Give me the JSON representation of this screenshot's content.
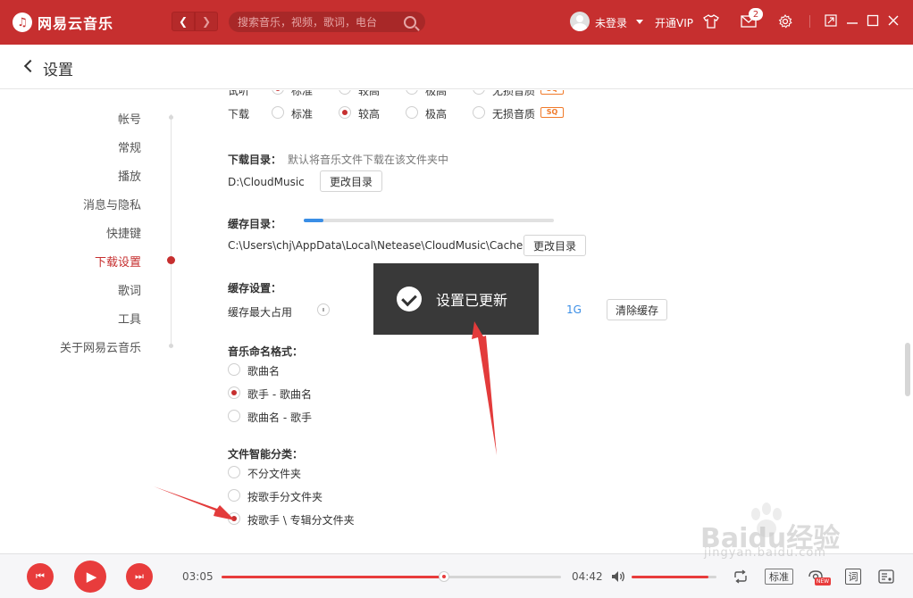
{
  "app": {
    "name": "网易云音乐",
    "logo_glyph": "♫"
  },
  "titlebar": {
    "search_placeholder": "搜索音乐，视频，歌词，电台",
    "login_text": "未登录",
    "vip_text": "开通VIP",
    "mail_count": "2",
    "accent_color": "#c62f2f"
  },
  "header": {
    "title": "设置"
  },
  "menu": {
    "items": [
      {
        "label": "帐号",
        "active": false
      },
      {
        "label": "常规",
        "active": false
      },
      {
        "label": "播放",
        "active": false
      },
      {
        "label": "消息与隐私",
        "active": false
      },
      {
        "label": "快捷键",
        "active": false
      },
      {
        "label": "下载设置",
        "active": true
      },
      {
        "label": "歌词",
        "active": false
      },
      {
        "label": "工具",
        "active": false
      },
      {
        "label": "关于网易云音乐",
        "active": false
      }
    ]
  },
  "settings": {
    "quality": {
      "row_label_partial": "试听",
      "download_label": "下载",
      "options": [
        "标准",
        "较高",
        "极高",
        "无损音质"
      ],
      "sq_badge": "SQ",
      "selected_download": "较高",
      "selected_trial": "标准"
    },
    "download_dir": {
      "title": "下载目录：",
      "description": "默认将音乐文件下载在该文件夹中",
      "path": "D:\\CloudMusic",
      "button": "更改目录"
    },
    "cache_dir": {
      "title": "缓存目录：",
      "path": "C:\\Users\\chj\\AppData\\Local\\Netease\\CloudMusic\\Cache",
      "button": "更改目录"
    },
    "cache_settings": {
      "title": "缓存设置：",
      "max_label": "缓存最大占用",
      "max_value": "1G",
      "slider_fraction": 0.08,
      "clear_button": "清除缓存"
    },
    "naming": {
      "title": "音乐命名格式：",
      "options": [
        "歌曲名",
        "歌手 - 歌曲名",
        "歌曲名 - 歌手"
      ],
      "selected": "歌手 - 歌曲名"
    },
    "classify": {
      "title": "文件智能分类：",
      "options": [
        "不分文件夹",
        "按歌手分文件夹",
        "按歌手 \\ 专辑分文件夹"
      ],
      "selected": "按歌手 \\ 专辑分文件夹"
    }
  },
  "toast": {
    "text": "设置已更新"
  },
  "player": {
    "current_time": "03:05",
    "total_time": "04:42",
    "progress_fraction": 0.655,
    "volume_fraction": 0.9,
    "quality_label": "标准",
    "new_badge": "NEW",
    "lyric_label": "词"
  },
  "watermark": {
    "text": "Baidu经验",
    "subtext": "jingyan.baidu.com"
  }
}
